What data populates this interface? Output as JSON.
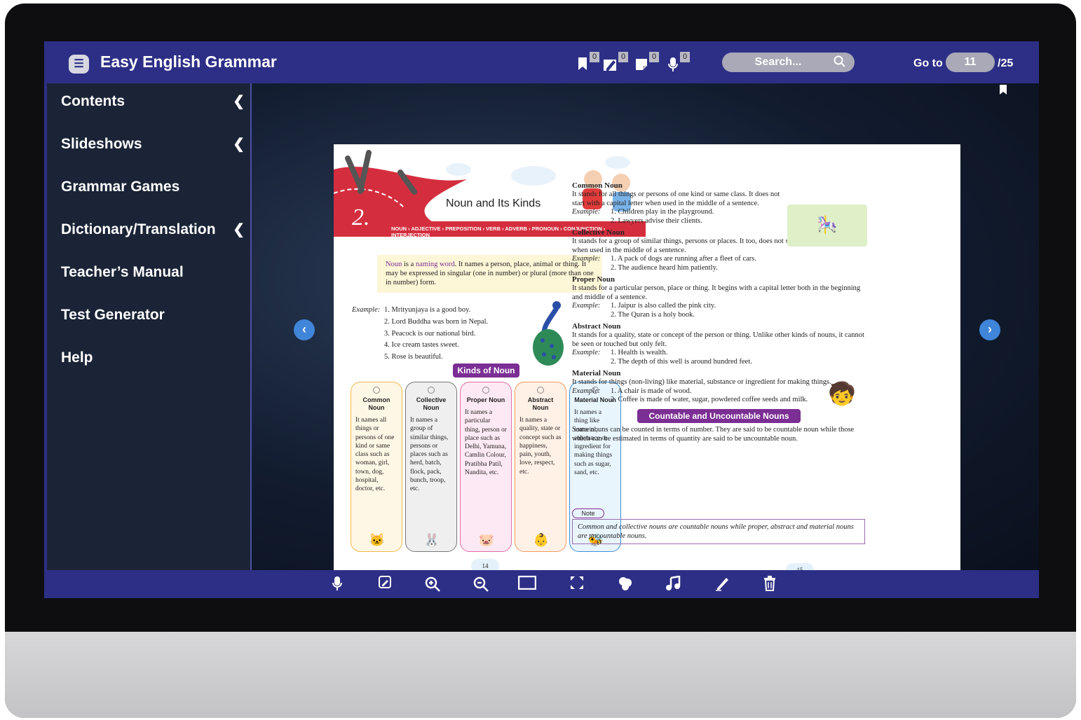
{
  "app": {
    "title": "Easy English Grammar"
  },
  "toolbar_badges": {
    "bookmarks": "0",
    "highlights": "0",
    "notes": "0",
    "recordings": "0"
  },
  "search": {
    "placeholder": "Search..."
  },
  "goto": {
    "label": "Go to",
    "value": "11",
    "total": "/25"
  },
  "sidebar": {
    "items": [
      {
        "label": "Contents"
      },
      {
        "label": "Slideshows"
      },
      {
        "label": "Grammar Games"
      },
      {
        "label": "Dictionary/Translation"
      },
      {
        "label": "Teacher’s Manual"
      },
      {
        "label": "Test Generator"
      },
      {
        "label": "Help"
      }
    ]
  },
  "left_page": {
    "chapter_number": "2.",
    "chapter_title": "Noun and Its Kinds",
    "kinds_strip": "NOUN › ADJECTIVE › PREPOSITION › VERB › ADVERB › PRONOUN › CONJUNCTION › INTERJECTION",
    "intro_highlight": "Noun",
    "intro_part1": " is a ",
    "intro_highlight2": "naming word",
    "intro_part2": ". It names a person, place, animal or thing. It may be expressed in singular (one in number) or plural (more than one in number) form.",
    "example_label": "Example:",
    "examples": [
      "1. Mrityunjaya is a good boy.",
      "2. Lord Buddha was born in Nepal.",
      "3. Peacock is our national bird.",
      "4. Ice cream tastes sweet.",
      "5. Rose is beautiful."
    ],
    "kinds_heading": "Kinds of Noun",
    "cards": [
      {
        "title": "Common Noun",
        "body": "It names all things or persons of one kind or same class such as woman, girl, town, dog, hospital, doctor, etc."
      },
      {
        "title": "Collective Noun",
        "body": "It names a group of similar things, persons or places such as herd, batch, flock, pack, bunch, troop, etc."
      },
      {
        "title": "Proper Noun",
        "body": "It names a particular thing, person or place such as Delhi, Yamuna, Camlin Colour, Pratibha Patil, Nandita, etc."
      },
      {
        "title": "Abstract Noun",
        "body": "It names a quality, state or concept such as happiness, pain, youth, love, respect, etc."
      },
      {
        "title": "Material Noun",
        "body": "It names a thing like material, substance or ingredient for making things such as sugar, sand, etc."
      }
    ],
    "page_number": "14"
  },
  "right_page": {
    "sections": [
      {
        "heading": "Common Noun",
        "text": "It stands for all things or persons of one kind or same class. It does not start with a capital letter when used in the middle of a sentence.",
        "examples": [
          "1. Children play in the playground.",
          "2. Lawyers advise their clients."
        ]
      },
      {
        "heading": "Collective Noun",
        "text": "It stands for a group of similar things, persons or places. It too, does not start with a capital letter when used in the middle of a sentence.",
        "examples": [
          "1. A pack of dogs are running after a fleet of cars.",
          "2. The audience heard him patiently."
        ]
      },
      {
        "heading": "Proper Noun",
        "text": "It stands for a particular person, place or thing. It begins with a capital letter both in the beginning and middle of a sentence.",
        "examples": [
          "1. Jaipur is also called the pink city.",
          "2. The Quran is a holy book."
        ]
      },
      {
        "heading": "Abstract Noun",
        "text": "It stands for a quality, state or concept of the person or thing. Unlike other kinds of nouns, it cannot be seen or touched but only felt.",
        "examples": [
          "1. Health is wealth.",
          "2. The depth of this well is around hundred feet."
        ]
      },
      {
        "heading": "Material Noun",
        "text": "It stands for things (non-living) like material, substance or ingredient for making things.",
        "examples": [
          "1. A chair is made of wood.",
          "2. Coffee is made of water, sugar, powdered coffee seeds and milk."
        ]
      }
    ],
    "example_label": "Example:",
    "countable_heading": "Countable and Uncountable Nouns",
    "countable_text": "Some nouns can be counted in terms of number. They are said to be countable noun while those which can be estimated in terms of quantity are said to be uncountable noun.",
    "note_label": "Note",
    "note_text": "Common and collective nouns are countable nouns while proper, abstract and material nouns are uncountable nouns.",
    "page_number": "15"
  },
  "icons": {
    "menu": "menu-icon",
    "bookmark": "bookmark-icon",
    "highlight": "pen-icon",
    "note": "note-icon",
    "mic": "microphone-icon",
    "search": "search-icon",
    "prev": "chevron-left-icon",
    "next": "chevron-right-icon"
  },
  "colors": {
    "bar": "#2d2f86",
    "sidebar": "#1a2436",
    "accent": "#7b2e94",
    "nav": "#3f85d9"
  }
}
